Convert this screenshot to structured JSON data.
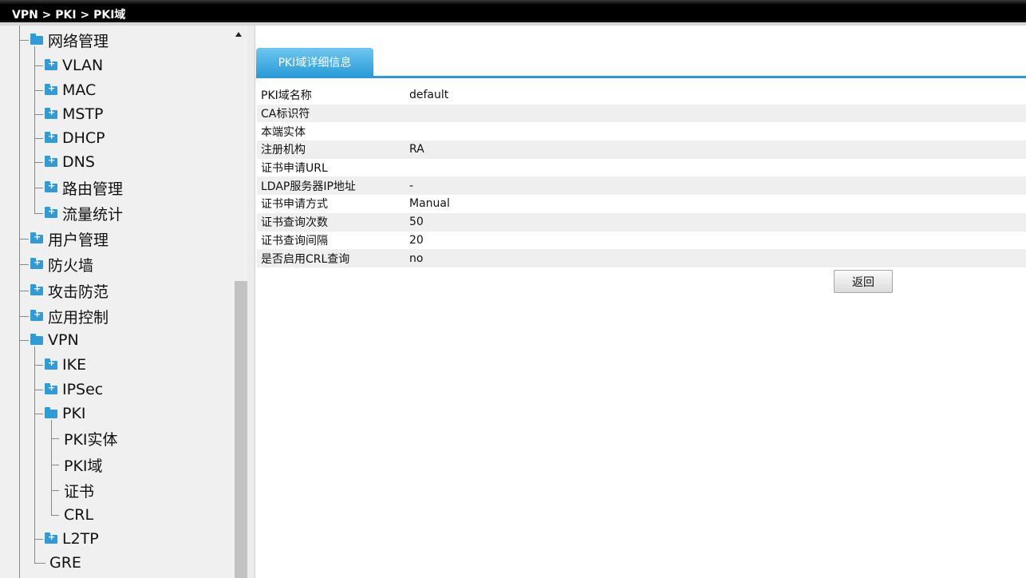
{
  "breadcrumb": "VPN > PKI > PKI域",
  "sidebar": {
    "items": [
      {
        "label": "网络管理",
        "level": 1,
        "icon": "folder-open-icon"
      },
      {
        "label": "VLAN",
        "level": 2,
        "icon": "folder-plus-icon"
      },
      {
        "label": "MAC",
        "level": 2,
        "icon": "folder-plus-icon"
      },
      {
        "label": "MSTP",
        "level": 2,
        "icon": "folder-plus-icon"
      },
      {
        "label": "DHCP",
        "level": 2,
        "icon": "folder-plus-icon"
      },
      {
        "label": "DNS",
        "level": 2,
        "icon": "folder-plus-icon"
      },
      {
        "label": "路由管理",
        "level": 2,
        "icon": "folder-plus-icon"
      },
      {
        "label": "流量统计",
        "level": 2,
        "icon": "folder-plus-icon"
      },
      {
        "label": "用户管理",
        "level": 1,
        "icon": "folder-plus-icon"
      },
      {
        "label": "防火墙",
        "level": 1,
        "icon": "folder-plus-icon"
      },
      {
        "label": "攻击防范",
        "level": 1,
        "icon": "folder-plus-icon"
      },
      {
        "label": "应用控制",
        "level": 1,
        "icon": "folder-plus-icon"
      },
      {
        "label": "VPN",
        "level": 1,
        "icon": "folder-open-icon"
      },
      {
        "label": "IKE",
        "level": 2,
        "icon": "folder-plus-icon"
      },
      {
        "label": "IPSec",
        "level": 2,
        "icon": "folder-plus-icon"
      },
      {
        "label": "PKI",
        "level": 2,
        "icon": "folder-open-icon"
      },
      {
        "label": "PKI实体",
        "level": 3,
        "icon": ""
      },
      {
        "label": "PKI域",
        "level": 3,
        "icon": ""
      },
      {
        "label": "证书",
        "level": 3,
        "icon": ""
      },
      {
        "label": "CRL",
        "level": 3,
        "icon": ""
      },
      {
        "label": "L2TP",
        "level": 2,
        "icon": "folder-plus-icon"
      },
      {
        "label": "GRE",
        "level": 2,
        "icon": ""
      }
    ]
  },
  "main": {
    "tab_label": "PKI域详细信息",
    "rows": [
      {
        "key": "PKI域名称",
        "value": "default"
      },
      {
        "key": "CA标识符",
        "value": ""
      },
      {
        "key": "本端实体",
        "value": ""
      },
      {
        "key": "注册机构",
        "value": "RA"
      },
      {
        "key": "证书申请URL",
        "value": ""
      },
      {
        "key": "LDAP服务器IP地址",
        "value": "-"
      },
      {
        "key": "证书申请方式",
        "value": "Manual"
      },
      {
        "key": "证书查询次数",
        "value": "50"
      },
      {
        "key": "证书查询间隔",
        "value": "20"
      },
      {
        "key": "是否启用CRL查询",
        "value": "no"
      }
    ],
    "back_label": "返回"
  },
  "colors": {
    "accent": "#2a9bd8",
    "topbar": "#000000",
    "sidebar_bg": "#f0f0f0"
  }
}
